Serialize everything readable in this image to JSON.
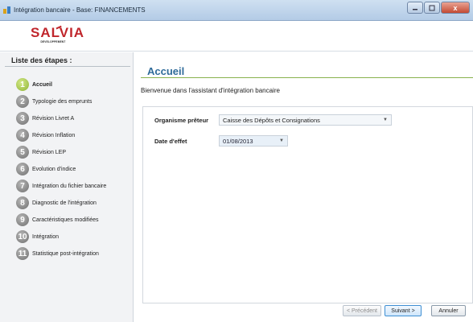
{
  "window": {
    "title": "Intégration bancaire - Base: FINANCEMENTS",
    "close_glyph": "x"
  },
  "logo": {
    "brand": "SALVIA",
    "subtitle": "DEVELOPPEMENT"
  },
  "sidebar": {
    "title": "Liste des étapes :",
    "steps": [
      {
        "number": "1",
        "label": "Accueil",
        "active": true
      },
      {
        "number": "2",
        "label": "Typologie des emprunts",
        "active": false
      },
      {
        "number": "3",
        "label": "Révision Livret A",
        "active": false
      },
      {
        "number": "4",
        "label": "Révision Inflation",
        "active": false
      },
      {
        "number": "5",
        "label": "Révision LEP",
        "active": false
      },
      {
        "number": "6",
        "label": "Evolution d'indice",
        "active": false
      },
      {
        "number": "7",
        "label": "Intégration du fichier bancaire",
        "active": false
      },
      {
        "number": "8",
        "label": "Diagnostic de l'intégration",
        "active": false
      },
      {
        "number": "9",
        "label": "Caractéristiques modifiées",
        "active": false
      },
      {
        "number": "10",
        "label": "Intégration",
        "active": false
      },
      {
        "number": "11",
        "label": "Statistique post-intégration",
        "active": false
      }
    ]
  },
  "main": {
    "title": "Accueil",
    "welcome": "Bienvenue dans l'assistant d'intégration bancaire",
    "lender_label": "Organisme prêteur",
    "lender_value": "Caisse des Dépôts et Consignations",
    "date_label": "Date d'effet",
    "date_value": "01/08/2013"
  },
  "footer": {
    "prev_label": "< Précédent",
    "next_label": "Suivant >",
    "cancel_label": "Annuler"
  },
  "colors": {
    "accent_title": "#2f6b9a",
    "accent_rule": "#88b24d",
    "active_step": "#8db432",
    "brand_red": "#c0262c"
  },
  "icons": {
    "app": "app-icon",
    "minimize": "minimize-icon",
    "maximize": "maximize-icon",
    "close": "close-icon",
    "dropdown": "chevron-down-icon"
  }
}
